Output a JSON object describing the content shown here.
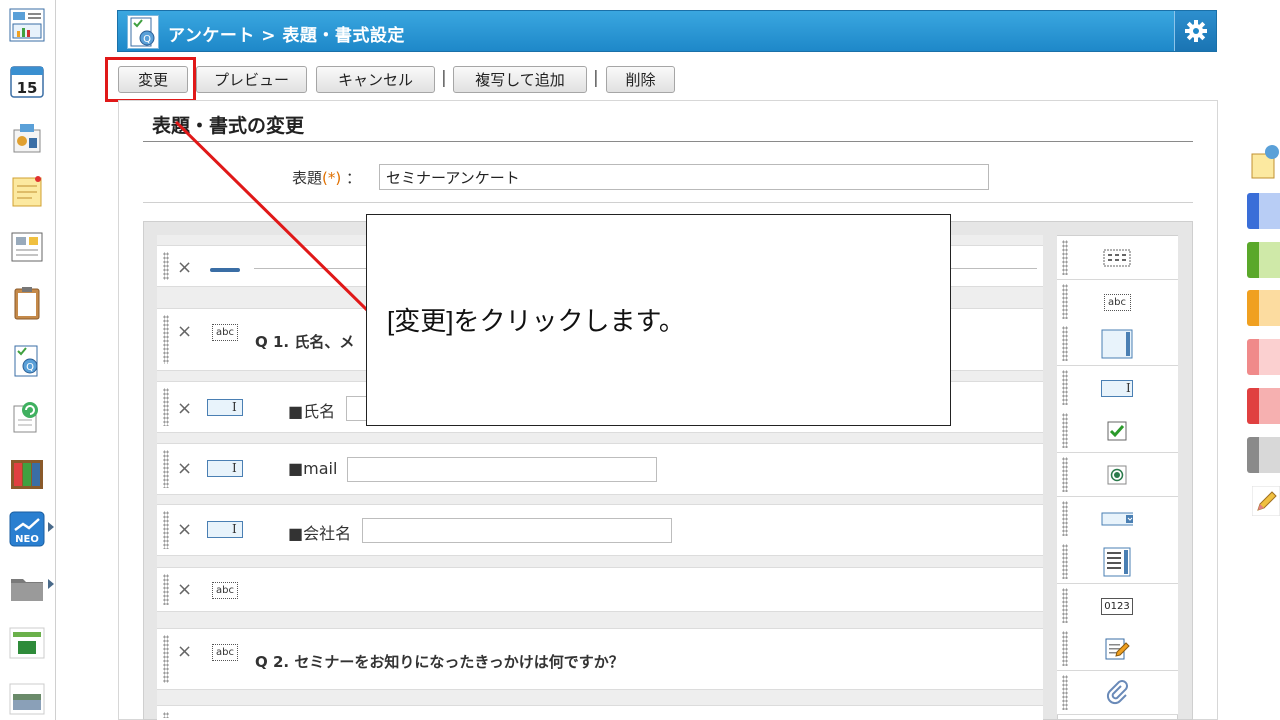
{
  "header": {
    "title": "アンケート > 表題・書式設定"
  },
  "toolbar": {
    "change_label": "変更",
    "preview_label": "プレビュー",
    "cancel_label": "キャンセル",
    "copy_add_label": "複写して追加",
    "delete_label": "削除",
    "separator": "|"
  },
  "section": {
    "title": "表題・書式の変更"
  },
  "form": {
    "title_label": "表題",
    "required_mark": "(*)",
    "colon": "：",
    "title_value": "セミナーアンケート"
  },
  "rows": [
    {
      "kind": "divider"
    },
    {
      "kind": "heading",
      "icon_text": "abc",
      "text": "Q 1. 氏名、メ"
    },
    {
      "kind": "text_input",
      "label": "■氏名"
    },
    {
      "kind": "text_input",
      "label": "■mail"
    },
    {
      "kind": "text_input",
      "label": "■会社名"
    },
    {
      "kind": "heading",
      "icon_text": "abc",
      "text": ""
    },
    {
      "kind": "heading",
      "icon_text": "abc",
      "text": "Q 2. セミナーをお知りになったきっかけは何ですか？"
    }
  ],
  "palette": {
    "icons": [
      "grid-text",
      "abc-label",
      "textarea",
      "text-input",
      "checkbox",
      "radio",
      "select",
      "list",
      "number",
      "memo",
      "attachment"
    ],
    "abc_text": "abc",
    "number_text": "0123"
  },
  "callout": {
    "text": "[変更]をクリックします。"
  },
  "colors": {
    "header_blue": "#1e88c9",
    "highlight_red": "#e01818",
    "required_orange": "#e07000"
  },
  "misc": {
    "delete_glyph": "×",
    "calendar_day": "15",
    "neo_text": "NEO"
  }
}
